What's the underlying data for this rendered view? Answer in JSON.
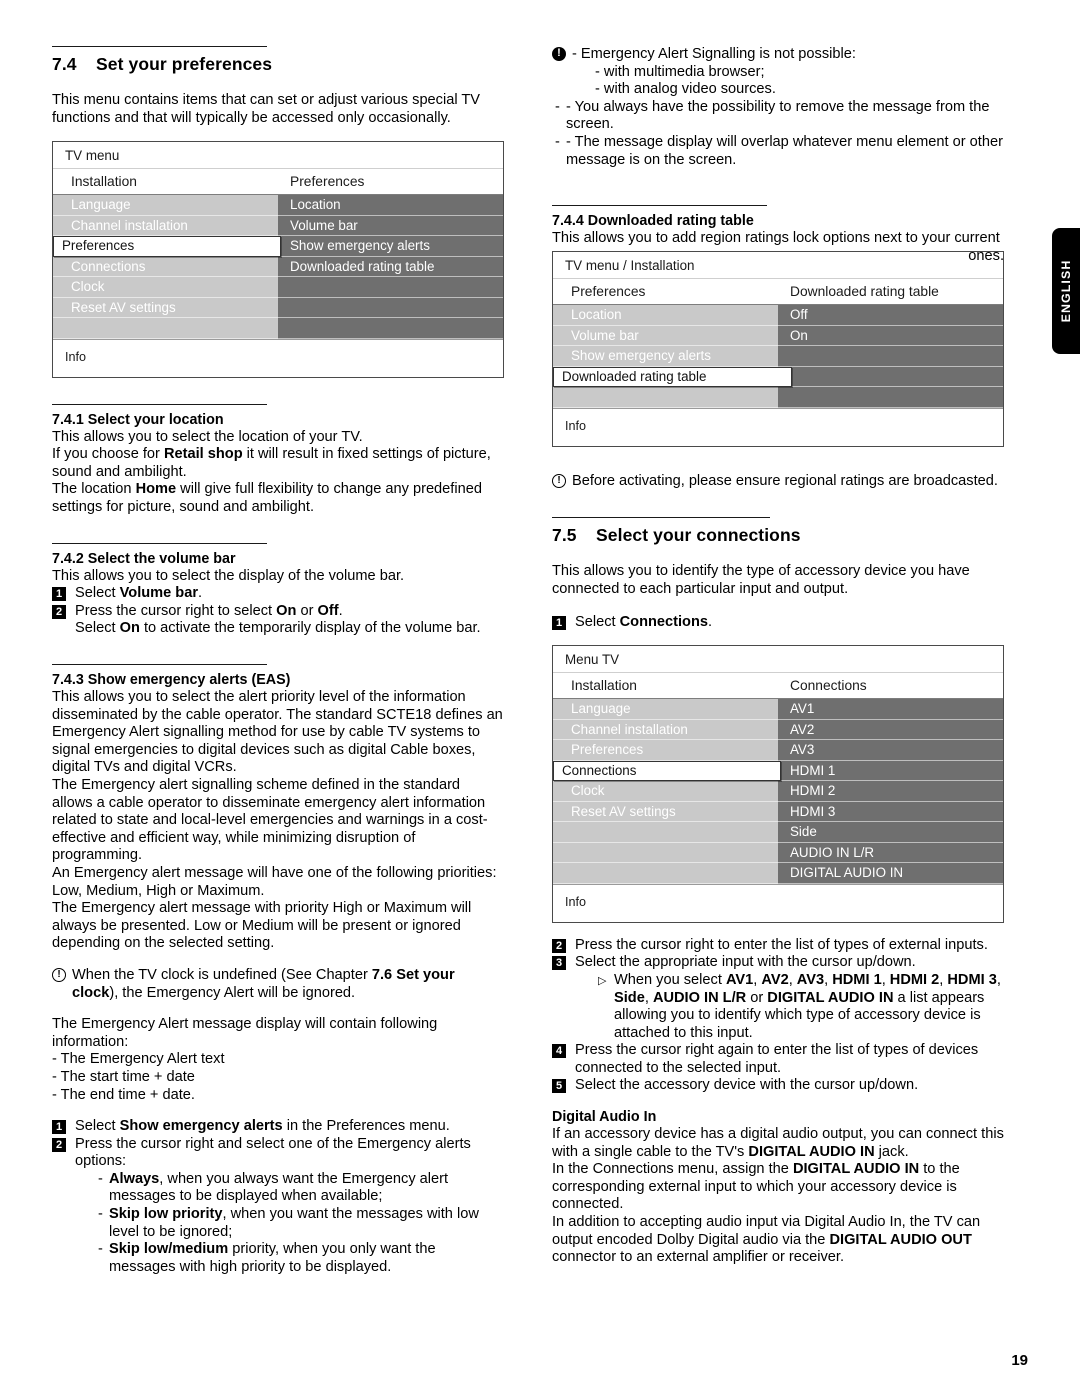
{
  "page": {
    "number": "19",
    "language_tab": "ENGLISH"
  },
  "left": {
    "s74": {
      "num": "7.4",
      "title": "Set your preferences",
      "intro": "This menu contains items that can set or adjust various special TV functions and that will typically be accessed only occasionally."
    },
    "menu1": {
      "header": "TV menu",
      "col_left_header": "Installation",
      "col_right_header": "Preferences",
      "left_items": [
        "Language",
        "Channel installation",
        "Preferences",
        "Connections",
        "Clock",
        "Reset AV settings",
        ""
      ],
      "left_selected_index": 2,
      "right_items": [
        "Location",
        "Volume bar",
        "Show emergency alerts",
        "Downloaded rating table",
        "",
        ""
      ],
      "footer": "Info"
    },
    "s741": {
      "heading": "7.4.1 Select your location",
      "p1": "This allows you to select the location of your TV.",
      "p2_a": "If you choose for ",
      "p2_b": "Retail shop",
      "p2_c": " it will result in fixed settings of picture, sound and ambilight.",
      "p3_a": "The location ",
      "p3_b": "Home",
      "p3_c": " will give full flexibility to change any predefined settings for picture, sound and ambilight."
    },
    "s742": {
      "heading": "7.4.2 Select the volume bar",
      "p1": "This allows you to select the display of the volume bar.",
      "step1_num": "1",
      "step1_a": "Select ",
      "step1_b": "Volume bar",
      "step1_c": ".",
      "step2_num": "2",
      "step2_a": "Press the cursor right to select ",
      "step2_b": "On",
      "step2_c": " or ",
      "step2_d": "Off",
      "step2_e": ".",
      "step2_line2_a": "Select ",
      "step2_line2_b": "On",
      "step2_line2_c": " to activate the temporarily display of the volume bar."
    },
    "s743": {
      "heading": "7.4.3 Show emergency alerts (EAS)",
      "p1": "This allows you to select the alert priority level of the information disseminated by the cable operator. The standard SCTE18 defines an Emergency Alert signalling method for use by cable TV systems to signal emergencies to digital devices such as digital Cable boxes, digital TVs and digital VCRs.",
      "p2": "The Emergency alert signalling scheme defined in the standard allows a cable operator to disseminate emergency alert information related to state and local-level emergencies and warnings in a cost-effective and efficient way, while minimizing disruption of programming.",
      "p3": "An Emergency alert message will have one of the following priorities: Low, Medium, High or Maximum.",
      "p4": "The Emergency alert message with priority High or Maximum will always be presented. Low or Medium will be present or ignored depending on the selected setting.",
      "note_a": "When the TV clock is undefined (See Chapter ",
      "note_b": "7.6 Set your clock",
      "note_c": "), the Emergency Alert will be ignored.",
      "p5": "The Emergency Alert message display will contain following information:",
      "bullets": [
        "- The Emergency Alert text",
        "- The start time + date",
        "- The end time + date."
      ],
      "step1_num": "1",
      "step1_a": "Select ",
      "step1_b": "Show emergency alerts",
      "step1_c": " in the Preferences menu.",
      "step2_num": "2",
      "step2_text": "Press the cursor right and select one of the Emergency alerts options:",
      "opt1_b": "Always",
      "opt1_t": ", when you always want the Emergency alert messages to be displayed when available;",
      "opt2_b": "Skip low priority",
      "opt2_t": ", when you want the messages with low level to be ignored;",
      "opt3_b": "Skip low/medium",
      "opt3_t": " priority, when you only want the messages with high priority to be displayed."
    }
  },
  "right": {
    "note_top": {
      "line1": "- Emergency Alert Signalling is not possible:",
      "line2": "- with multimedia browser;",
      "line3": "- with analog video sources.",
      "bullet1": "- You always have the possibility to remove the message from the screen.",
      "bullet2": "- The message display will overlap whatever menu element or other message is on the screen."
    },
    "s744": {
      "heading": "7.4.4 Downloaded rating table",
      "p1": "This allows you to add region ratings lock options next to your current",
      "p1_tail": "ones."
    },
    "menu2": {
      "header": "TV menu / Installation",
      "col_left_header": "Preferences",
      "col_right_header": "Downloaded rating table",
      "left_items": [
        "Location",
        "Volume bar",
        "Show emergency alerts",
        "Downloaded rating table",
        ""
      ],
      "left_selected_index": 3,
      "right_items": [
        "Off",
        "On",
        "",
        "",
        "",
        ""
      ],
      "footer": "Info"
    },
    "note_ratings": "Before activating, please ensure regional ratings are broadcasted.",
    "s75": {
      "num": "7.5",
      "title": "Select your connections",
      "intro": "This allows you to identify the type of accessory device you have connected to each particular input and output.",
      "step1_num": "1",
      "step1_a": "Select ",
      "step1_b": "Connections",
      "step1_c": "."
    },
    "menu3": {
      "header": "Menu TV",
      "col_left_header": "Installation",
      "col_right_header": "Connections",
      "left_items": [
        "Language",
        "Channel installation",
        "Preferences",
        "Connections",
        "Clock",
        "Reset AV settings",
        "",
        "",
        ""
      ],
      "left_selected_index": 3,
      "right_items": [
        "AV1",
        "AV2",
        "AV3",
        "HDMI 1",
        "HDMI 2",
        "HDMI 3",
        "Side",
        "AUDIO IN L/R",
        "DIGITAL AUDIO IN"
      ],
      "footer": "Info"
    },
    "steps": {
      "step2_num": "2",
      "step2_text": "Press the cursor right to enter the list of types of external inputs.",
      "step3_num": "3",
      "step3_text": "Select the appropriate input with the cursor up/down.",
      "sub_tri": "▷",
      "sub_a": "When you select ",
      "sub_b1": "AV1",
      "sub_b2": "AV2",
      "sub_b3": "AV3",
      "sub_b4": "HDMI 1",
      "sub_b5": "HDMI 2",
      "sub_b6": "HDMI 3",
      "sub_b7": "Side",
      "sub_b8": "AUDIO IN L/R",
      "sub_b9": "DIGITAL AUDIO IN",
      "sub_or": " or ",
      "sub_tail": " a list appears allowing you to identify which type of accessory device is attached to this input.",
      "step4_num": "4",
      "step4_text": "Press the cursor right again to enter the list of types of devices connected to the selected input.",
      "step5_num": "5",
      "step5_text": "Select the accessory device with the cursor up/down."
    },
    "digital": {
      "heading": "Digital Audio In",
      "p1_a": "If an accessory device has a digital audio output, you can connect this with a single cable to the TV's ",
      "p1_b": "DIGITAL AUDIO IN",
      "p1_c": " jack.",
      "p2_a": "In the Connections menu, assign the ",
      "p2_b": "DIGITAL AUDIO IN",
      "p2_c": " to the corresponding external input to which your accessory device is connected.",
      "p3_a": "In addition to accepting audio input via Digital Audio In, the TV can output encoded Dolby Digital audio via the ",
      "p3_b": "DIGITAL AUDIO OUT",
      "p3_c": " connector to an external amplifier or receiver."
    }
  }
}
